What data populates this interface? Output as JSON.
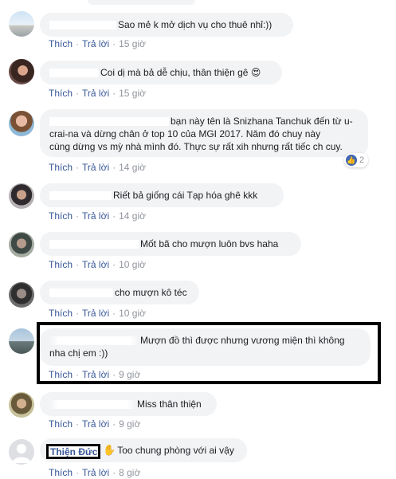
{
  "labels": {
    "like": "Thích",
    "reply": "Trả lời"
  },
  "comments": [
    {
      "id": 1,
      "text": "Sao mẻ k mở dịch vụ cho thuê nhỉ:))",
      "time": "15 giờ"
    },
    {
      "id": 2,
      "text": "Coi dị mà bả dễ chịu, thân thiện gê",
      "emoji": "😍",
      "time": "15 giờ"
    },
    {
      "id": 3,
      "text_line1": "bạn này tên là Snizhana Tanchuk đến từ u-",
      "text_line2": "crai-na và dừng chân ở top 10 của MGI 2017. Năm đó chuy này",
      "text_line3": "cùng dừng vs mỳ nhà mình đó. Thực sự rất xih nhưng rất tiếc ch cuy.",
      "time": "14 giờ",
      "reaction_count": "2"
    },
    {
      "id": 4,
      "text": "Riết bả giống cái Tạp hóa ghê kkk",
      "time": "14 giờ"
    },
    {
      "id": 5,
      "text": "Mốt bã cho mượn luôn bvs haha",
      "time": "10 giờ"
    },
    {
      "id": 6,
      "text": "cho mượn kô téc",
      "time": "10 giờ"
    },
    {
      "id": 7,
      "text_line1": "Mượn đồ thì được nhưng vương miện thì không",
      "text_line2": "nha chị em :))",
      "time": "9 giờ"
    },
    {
      "id": 8,
      "text": "Miss thân thiện",
      "time": "9 giờ"
    },
    {
      "id": 9,
      "name": "Thiện Đức",
      "text": "Too chung phòng với ai vậy",
      "time": "8 giờ"
    }
  ]
}
